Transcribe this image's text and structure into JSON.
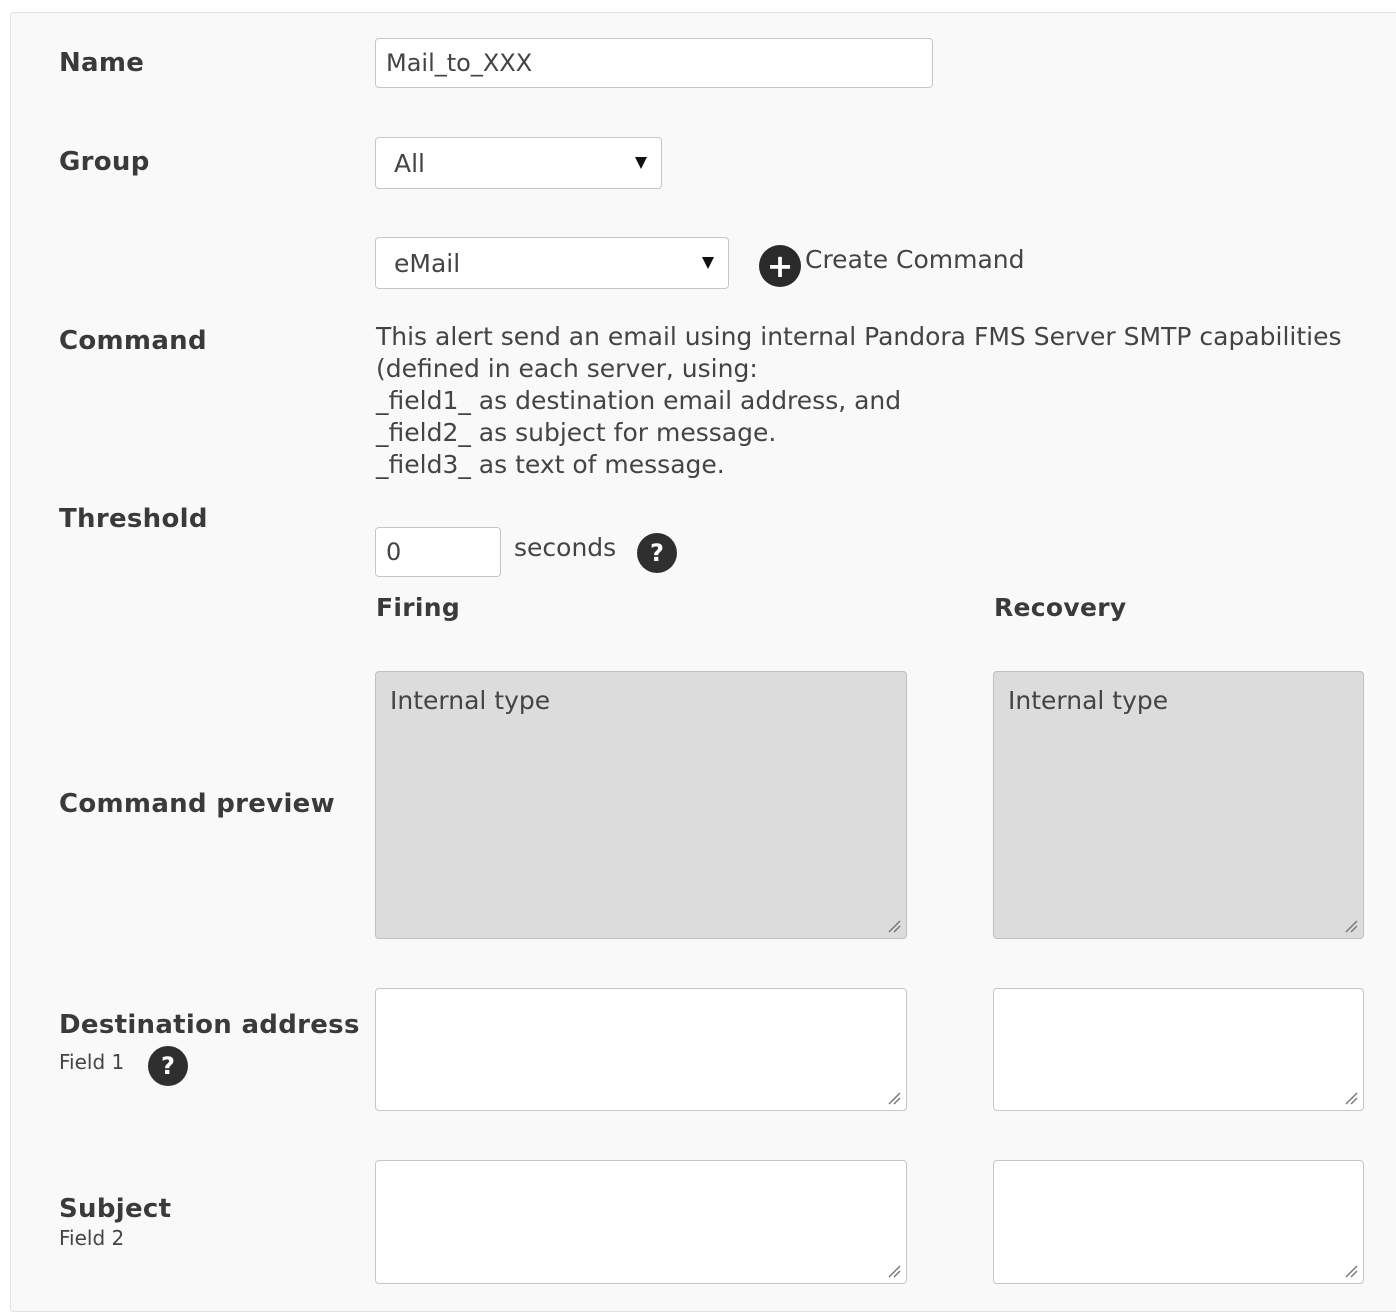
{
  "form": {
    "name": {
      "label": "Name",
      "value": "Mail_to_XXX"
    },
    "group": {
      "label": "Group",
      "selected": "All"
    },
    "command": {
      "label": "Command",
      "selected": "eMail",
      "create_label": "Create Command",
      "description": [
        "This alert send an email using internal Pandora FMS Server SMTP capabilities",
        "(defined in each server, using:",
        "_field1_ as destination email address, and",
        "_field2_ as subject for message.",
        "_field3_ as text of message."
      ]
    },
    "threshold": {
      "label": "Threshold",
      "value": "0",
      "unit": "seconds"
    },
    "columns": {
      "firing": "Firing",
      "recovery": "Recovery"
    },
    "command_preview": {
      "label": "Command preview",
      "firing": "Internal type",
      "recovery": "Internal type"
    },
    "destination_address": {
      "label": "Destination address",
      "sublabel": "Field 1",
      "firing": "",
      "recovery": ""
    },
    "subject": {
      "label": "Subject",
      "sublabel": "Field 2",
      "firing": "",
      "recovery": ""
    }
  },
  "icons": {
    "help": "?",
    "add": "+"
  }
}
